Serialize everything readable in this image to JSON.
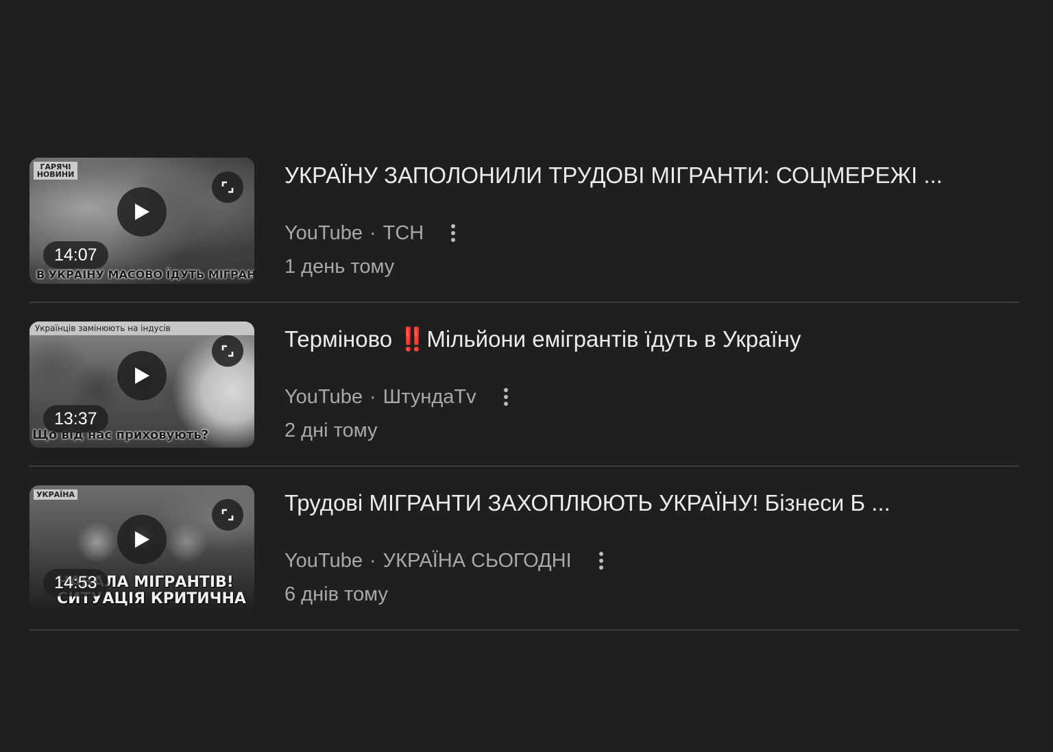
{
  "results": [
    {
      "title": "УКРАЇНУ ЗАПОЛОНИЛИ ТРУДОВІ МІГРАНТИ: СОЦМЕРЕЖІ ...",
      "title_emphasis": "",
      "title_rest": "",
      "source": "YouTube",
      "separator": "·",
      "channel": "ТСН",
      "age": "1 день тому",
      "duration": "14:07",
      "thumb_badge": "ГАРЯЧІ НОВИНИ",
      "thumb_topline": "",
      "thumb_caption": "В УКРАЇНУ МАСОВО ЇДУТЬ МІГРАНТИ!"
    },
    {
      "title": "Терміново ",
      "title_emphasis": "‼️",
      "title_rest": "Мільйони емігрантів їдуть в Україну",
      "source": "YouTube",
      "separator": "·",
      "channel": "ШтундаTv",
      "age": "2 дні тому",
      "duration": "13:37",
      "thumb_badge": "",
      "thumb_topline": "Українців замінюють на індусів",
      "thumb_caption": "Що від нас приховують?"
    },
    {
      "title": "Трудові МІГРАНТИ ЗАХОПЛЮЮТЬ УКРАЇНУ! Бізнеси Б ...",
      "title_emphasis": "",
      "title_rest": "",
      "source": "YouTube",
      "separator": "·",
      "channel": "УКРАЇНА СЬОГОДНІ",
      "age": "6 днів тому",
      "duration": "14:53",
      "thumb_badge": "УКРАЇНА",
      "thumb_topline": "",
      "thumb_caption": "НАВАЛА МІГРАНТІВ! СИТУАЦІЯ КРИТИЧНА"
    }
  ],
  "colors": {
    "background": "#1f1f1f",
    "title_text": "#ececec",
    "meta_text": "#a9a9a9",
    "divider": "#3c3c3c"
  },
  "icons": {
    "play": "play-icon",
    "expand": "expand-icon",
    "more": "more-vert-icon"
  }
}
